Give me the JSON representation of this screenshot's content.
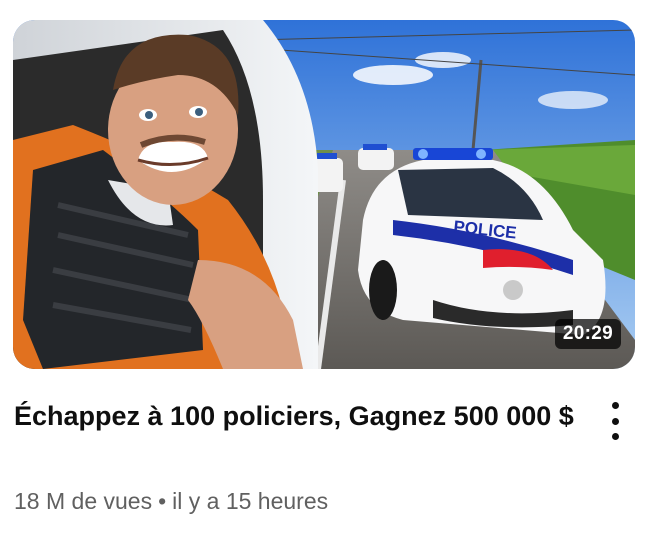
{
  "video": {
    "title": "Échappez à 100 policiers, Gagnez 500 000 $",
    "duration": "20:29",
    "views": "18 M de vues",
    "separator": "•",
    "age": "il y a 15 heures",
    "thumbnail_car_text": "POLICE"
  },
  "icons": {
    "more": "more-vert-icon"
  }
}
